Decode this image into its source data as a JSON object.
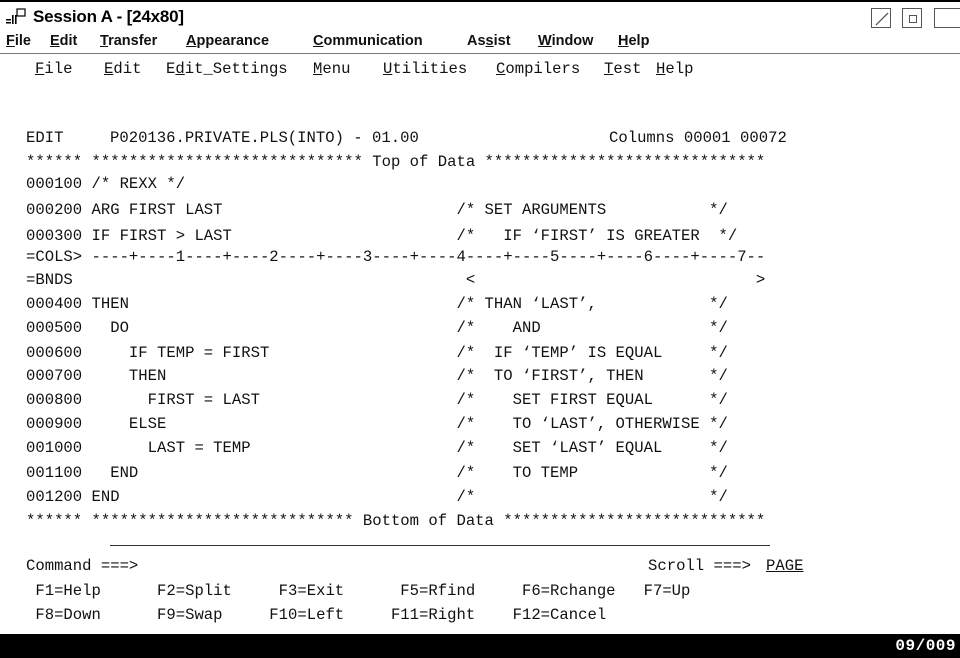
{
  "window": {
    "title": "Session A - [24x80]"
  },
  "menubar": {
    "items": [
      {
        "label": "File"
      },
      {
        "label": "Edit"
      },
      {
        "label": "Transfer"
      },
      {
        "label": "Appearance"
      },
      {
        "label": "Communication"
      },
      {
        "label": "Assist"
      },
      {
        "label": "Window"
      },
      {
        "label": "Help"
      }
    ]
  },
  "ispf_menu": {
    "items": [
      {
        "label": "File"
      },
      {
        "label": "Edit"
      },
      {
        "label": "Edit_Settings"
      },
      {
        "label": "Menu"
      },
      {
        "label": "Utilities"
      },
      {
        "label": "Compilers"
      },
      {
        "label": "Test"
      },
      {
        "label": "Help"
      }
    ]
  },
  "editor": {
    "header_mode": "EDIT",
    "dataset": "P020136.PRIVATE.PLS(INTO) - 01.00",
    "columns": "Columns 00001 00072",
    "top_of_data": "****** ***************************** Top of Data ******************************",
    "bottom_of_data": "****** **************************** Bottom of Data ****************************",
    "lines": [
      "000100 /* REXX */",
      "000200 ARG FIRST LAST                         /* SET ARGUMENTS           */",
      "000300 IF FIRST > LAST                        /*   IF ‘FIRST’ IS GREATER  */",
      "=COLS> ----+----1----+----2----+----3----+----4----+----5----+----6----+----7--",
      "=BNDS                                          <                              >",
      "000400 THEN                                   /* THAN ‘LAST’,            */",
      "000500   DO                                   /*    AND                  */",
      "000600     IF TEMP = FIRST                    /*  IF ‘TEMP’ IS EQUAL     */",
      "000700     THEN                               /*  TO ‘FIRST’, THEN       */",
      "000800       FIRST = LAST                     /*    SET FIRST EQUAL      */",
      "000900     ELSE                               /*    TO ‘LAST’, OTHERWISE */",
      "001000       LAST = TEMP                      /*    SET ‘LAST’ EQUAL     */",
      "001100   END                                  /*    TO TEMP              */",
      "001200 END                                    /*                         */"
    ]
  },
  "command": {
    "prompt": "Command ===>",
    "scroll_label": "Scroll ===>",
    "scroll_value": "PAGE"
  },
  "function_keys": {
    "row1": " F1=Help      F2=Split     F3=Exit      F5=Rfind     F6=Rchange   F7=Up",
    "row2": " F8=Down      F9=Swap     F10=Left     F11=Right    F12=Cancel"
  },
  "status": {
    "cursor": "09/009"
  }
}
